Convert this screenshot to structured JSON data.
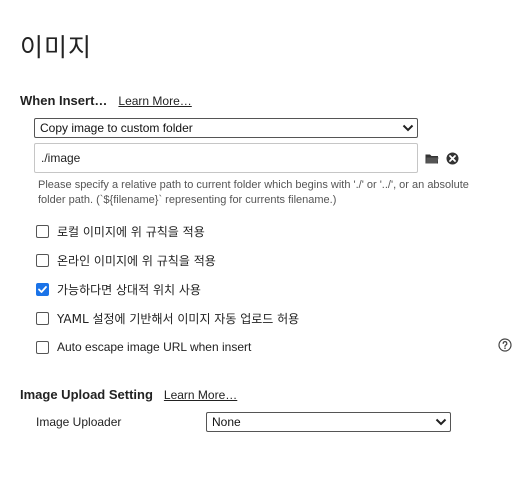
{
  "page": {
    "title": "이미지"
  },
  "when_insert": {
    "title": "When Insert…",
    "learn_more": "Learn More…",
    "action_select": {
      "selected": "Copy image to custom folder"
    },
    "path_input": {
      "value": "./image"
    },
    "hint": "Please specify a relative path to current folder which begins with './' or '../', or an absolute folder path. (`${filename}` representing for currents filename.)",
    "icons": {
      "browse": "folder-icon",
      "clear": "clear-circle-icon"
    },
    "options": [
      {
        "label": "로컬 이미지에 위 규칙을 적용",
        "checked": false
      },
      {
        "label": "온라인 이미지에 위 규칙을 적용",
        "checked": false
      },
      {
        "label": "가능하다면 상대적 위치 사용",
        "checked": true
      },
      {
        "label": "YAML 설정에 기반해서 이미지 자동 업로드 허용",
        "checked": false
      },
      {
        "label": "Auto escape image URL when insert",
        "checked": false
      }
    ],
    "help_icon": "question-circle-icon"
  },
  "upload": {
    "title": "Image Upload Setting",
    "learn_more": "Learn More…",
    "uploader_label": "Image Uploader",
    "uploader_select": {
      "selected": "None"
    }
  },
  "colors": {
    "accent": "#1a73e8",
    "text": "#222222",
    "hint": "#555555"
  }
}
